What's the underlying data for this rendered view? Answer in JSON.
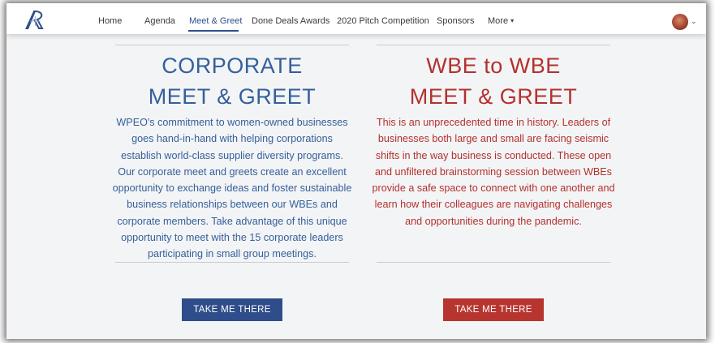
{
  "nav": {
    "items": [
      {
        "label": "Home"
      },
      {
        "label": "Agenda"
      },
      {
        "label": "Meet & Greet"
      },
      {
        "label": "Done Deals Awards"
      },
      {
        "label": "2020 Pitch Competition"
      },
      {
        "label": "Sponsors"
      },
      {
        "label": "More"
      }
    ],
    "more_caret": "▾",
    "avatar_caret": "⌄"
  },
  "corporate": {
    "title_line1": "CORPORATE",
    "title_line2": "MEET & GREET",
    "lines": [
      "WPEO's commitment to women-owned businesses",
      "goes hand-in-hand with helping corporations",
      "establish world-class supplier diversity programs.",
      "Our corporate meet and greets create an excellent",
      "opportunity to exchange ideas and foster sustainable",
      "business relationships between our WBEs and",
      "corporate members. Take advantage of this unique",
      "opportunity to meet with the 15 corporate leaders",
      "participating in small group meetings."
    ],
    "button_label": "TAKE ME THERE"
  },
  "wbe": {
    "title_line1": "WBE to WBE",
    "title_line2": "MEET & GREET",
    "lines": [
      "This is an unprecedented time in history. Leaders of",
      "businesses both large and small are facing seismic",
      "shifts in the way business is conducted. These open",
      "and unfiltered brainstorming session between WBEs",
      "provide a safe space to connect with one another and",
      "learn how their colleagues are navigating challenges",
      "and opportunities during the pandemic."
    ],
    "button_label": "TAKE ME THERE"
  },
  "colors": {
    "blue": "#34609a",
    "red": "#b3312d",
    "blue_button": "#2f4d8a",
    "red_button": "#b7352f",
    "background": "#f3f4f6"
  }
}
